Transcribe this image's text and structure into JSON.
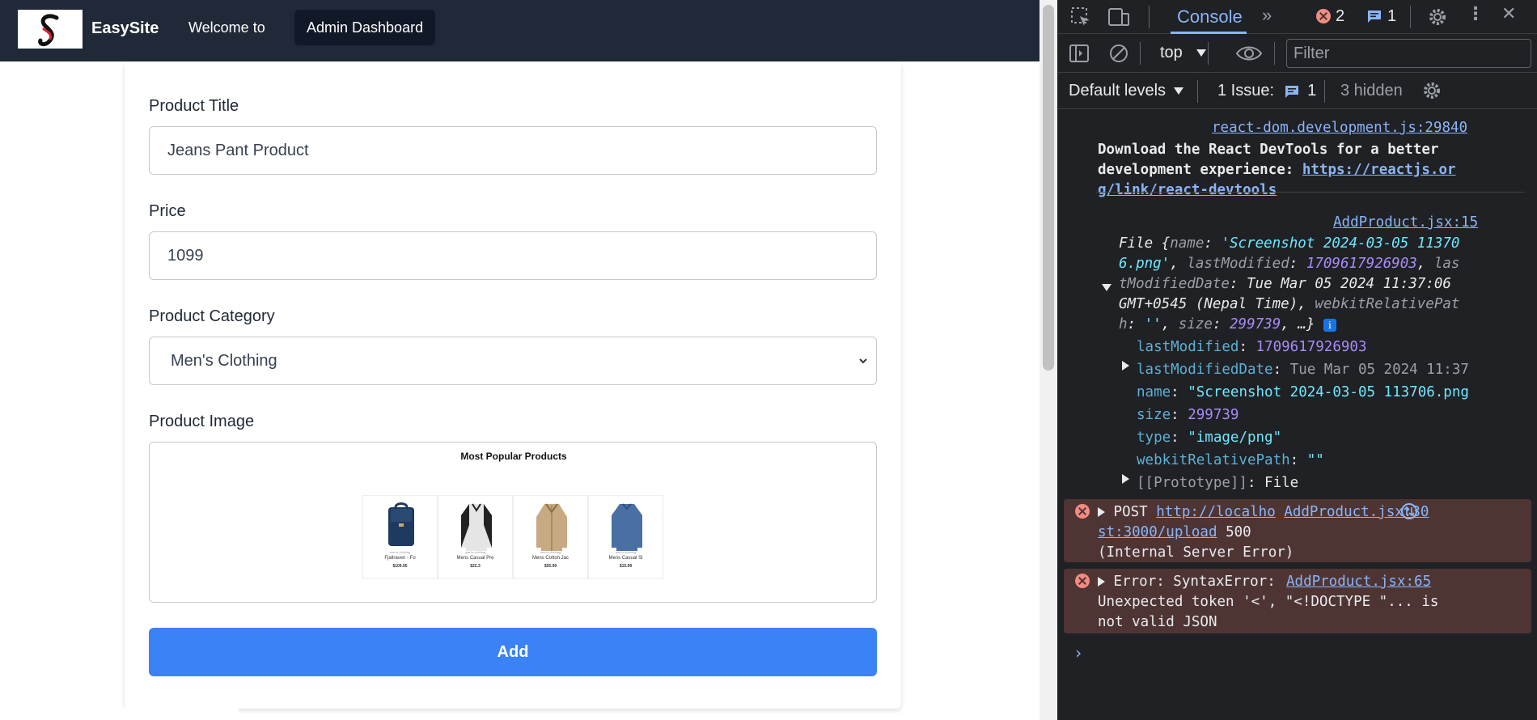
{
  "app": {
    "brand": "EasySite",
    "nav": {
      "welcome": "Welcome to",
      "admin": "Admin Dashboard"
    }
  },
  "form": {
    "title_label": "Product Title",
    "title_value": "Jeans Pant Product",
    "price_label": "Price",
    "price_value": "1099",
    "category_label": "Product Category",
    "category_value": "Men's Clothing",
    "image_label": "Product Image",
    "preview": {
      "title": "Most Popular Products",
      "products": [
        {
          "category": "men's clothing",
          "name": "Fjallraven - Fo",
          "price": "$109.95",
          "icon": "backpack-image"
        },
        {
          "category": "men's clothing",
          "name": "Mens Casual Pre",
          "price": "$22.3",
          "icon": "tshirt-image"
        },
        {
          "category": "men's clothing",
          "name": "Mens Cotton Jac",
          "price": "$55.99",
          "icon": "jacket-image"
        },
        {
          "category": "men's clothing",
          "name": "Mens Casual Sl",
          "price": "$15.99",
          "icon": "longsleeve-image"
        }
      ]
    },
    "add_button": "Add"
  },
  "devtools": {
    "tab": "Console",
    "error_count": "2",
    "message_count": "1",
    "context": "top",
    "filter_placeholder": "Filter",
    "levels": "Default levels",
    "issue_label": "1 Issue:",
    "issue_count": "1",
    "hidden": "3 hidden",
    "log": {
      "devtools_src": "react-dom.development.js:29840",
      "devtools_msg": "Download the React DevTools for a better development experience: ",
      "devtools_link_1": "https://reactjs.or",
      "devtools_link_2": "g/link/react-devtools",
      "file_src": "AddProduct.jsx:15",
      "file_line1_pre": "File {",
      "file_line1_key": "name",
      "file_line1_val": "'Screenshot 2024-03-05 11370",
      "file_line2_val": "6.png'",
      "file_line2_key": "lastModified",
      "file_line2_num": "1709617926903",
      "file_line2_tail": "las",
      "file_line3_key": "tModifiedDate",
      "file_line3_val": "Tue Mar 05 2024 11:37:06",
      "file_line4_val": "GMT+0545 (Nepal Time)",
      "file_line4_key": "webkitRelativePat",
      "file_line5_key": "h",
      "file_line5_str": "''",
      "file_line5_size_key": "size",
      "file_line5_size": "299739",
      "file_line5_tail": "…}",
      "prop_lastModified_key": "lastModified",
      "prop_lastModified_val": "1709617926903",
      "prop_lastModifiedDate_key": "lastModifiedDate",
      "prop_lastModifiedDate_val": "Tue Mar 05 2024 11:37",
      "prop_name_key": "name",
      "prop_name_val": "\"Screenshot 2024-03-05 113706.png",
      "prop_size_key": "size",
      "prop_size_val": "299739",
      "prop_type_key": "type",
      "prop_type_val": "\"image/png\"",
      "prop_wrp_key": "webkitRelativePath",
      "prop_wrp_val": "\"\"",
      "prop_proto_key": "[[Prototype]]",
      "prop_proto_val": "File",
      "err1_method": "POST",
      "err1_url1": "http://localho",
      "err1_url2": "st:3000/upload",
      "err1_src": "AddProduct.jsx:30",
      "err1_status": "500",
      "err1_text": "(Internal Server Error)",
      "err2_line1": "Error: SyntaxError:",
      "err2_src": "AddProduct.jsx:65",
      "err2_line2": "Unexpected token '<', \"<!DOCTYPE \"... is",
      "err2_line3": "not valid JSON"
    }
  }
}
